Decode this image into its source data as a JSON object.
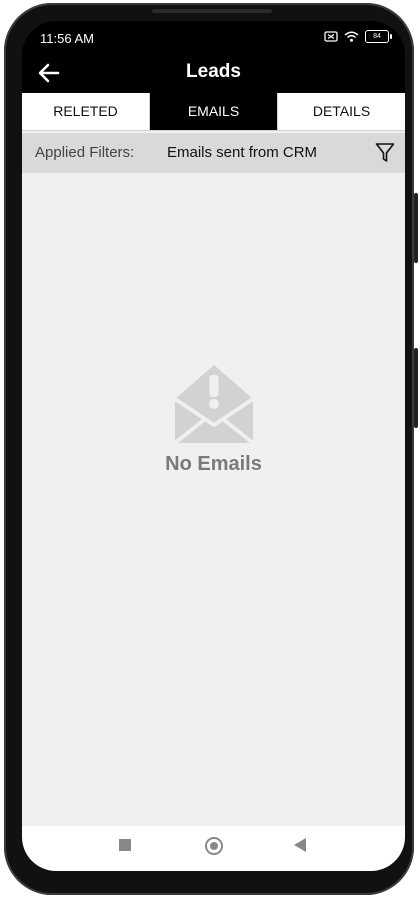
{
  "status": {
    "time": "11:56 AM",
    "battery": "84"
  },
  "appbar": {
    "title": "Leads"
  },
  "tabs": [
    {
      "label": "RELETED",
      "active": false
    },
    {
      "label": "EMAILS",
      "active": true
    },
    {
      "label": "DETAILS",
      "active": false
    }
  ],
  "filter": {
    "label": "Applied Filters:",
    "value": "Emails sent from CRM"
  },
  "empty_state": {
    "message": "No Emails"
  },
  "icons": {
    "back": "arrow-left-icon",
    "filter": "funnel-icon",
    "empty": "envelope-alert-icon",
    "nav_recent": "square-icon",
    "nav_home": "circle-icon",
    "nav_back": "triangle-icon"
  }
}
